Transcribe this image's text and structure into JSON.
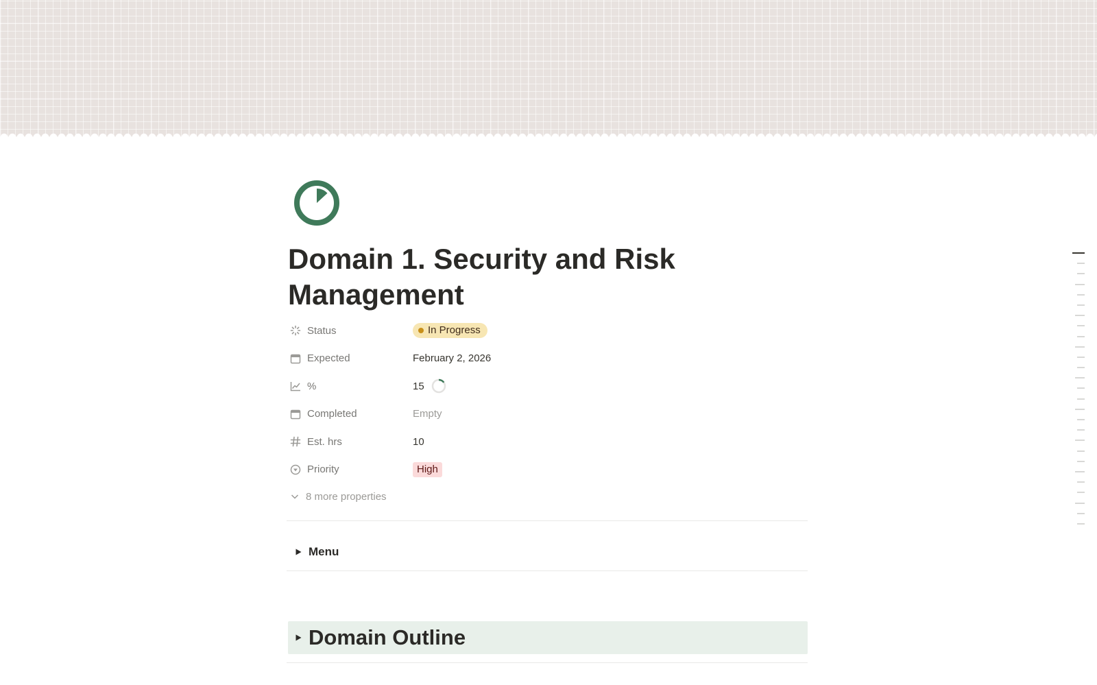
{
  "cover": {
    "pattern": "plaid-grid",
    "color": "#e8e2df"
  },
  "page": {
    "icon": "pie-progress-icon",
    "icon_color": "#3f7a5a",
    "title": "Domain 1. Security and Risk Management"
  },
  "properties": [
    {
      "name": "status",
      "icon": "status-icon",
      "label": "Status",
      "value": "In Progress",
      "type": "status"
    },
    {
      "name": "expected",
      "icon": "calendar-icon",
      "label": "Expected",
      "value": "February 2, 2026",
      "type": "date"
    },
    {
      "name": "percent",
      "icon": "chart-icon",
      "label": "%",
      "value": "15",
      "progress": 0.15,
      "type": "progress"
    },
    {
      "name": "completed",
      "icon": "calendar-icon",
      "label": "Completed",
      "value": "Empty",
      "type": "empty"
    },
    {
      "name": "est-hrs",
      "icon": "hash-icon",
      "label": "Est. hrs",
      "value": "10",
      "type": "number"
    },
    {
      "name": "priority",
      "icon": "priority-icon",
      "label": "Priority",
      "value": "High",
      "type": "select"
    }
  ],
  "more_properties": {
    "label": "8 more properties"
  },
  "blocks": {
    "menu_toggle": {
      "label": "Menu"
    },
    "domain_outline_toggle": {
      "label": "Domain Outline"
    }
  },
  "colors": {
    "status_bg": "#f7e6b3",
    "status_dot": "#c8901a",
    "priority_bg": "#fbdada",
    "outline_bg": "#e8f0ea",
    "accent_green": "#3f7a5a"
  },
  "toc": {
    "items": 27,
    "active_index": 0
  }
}
